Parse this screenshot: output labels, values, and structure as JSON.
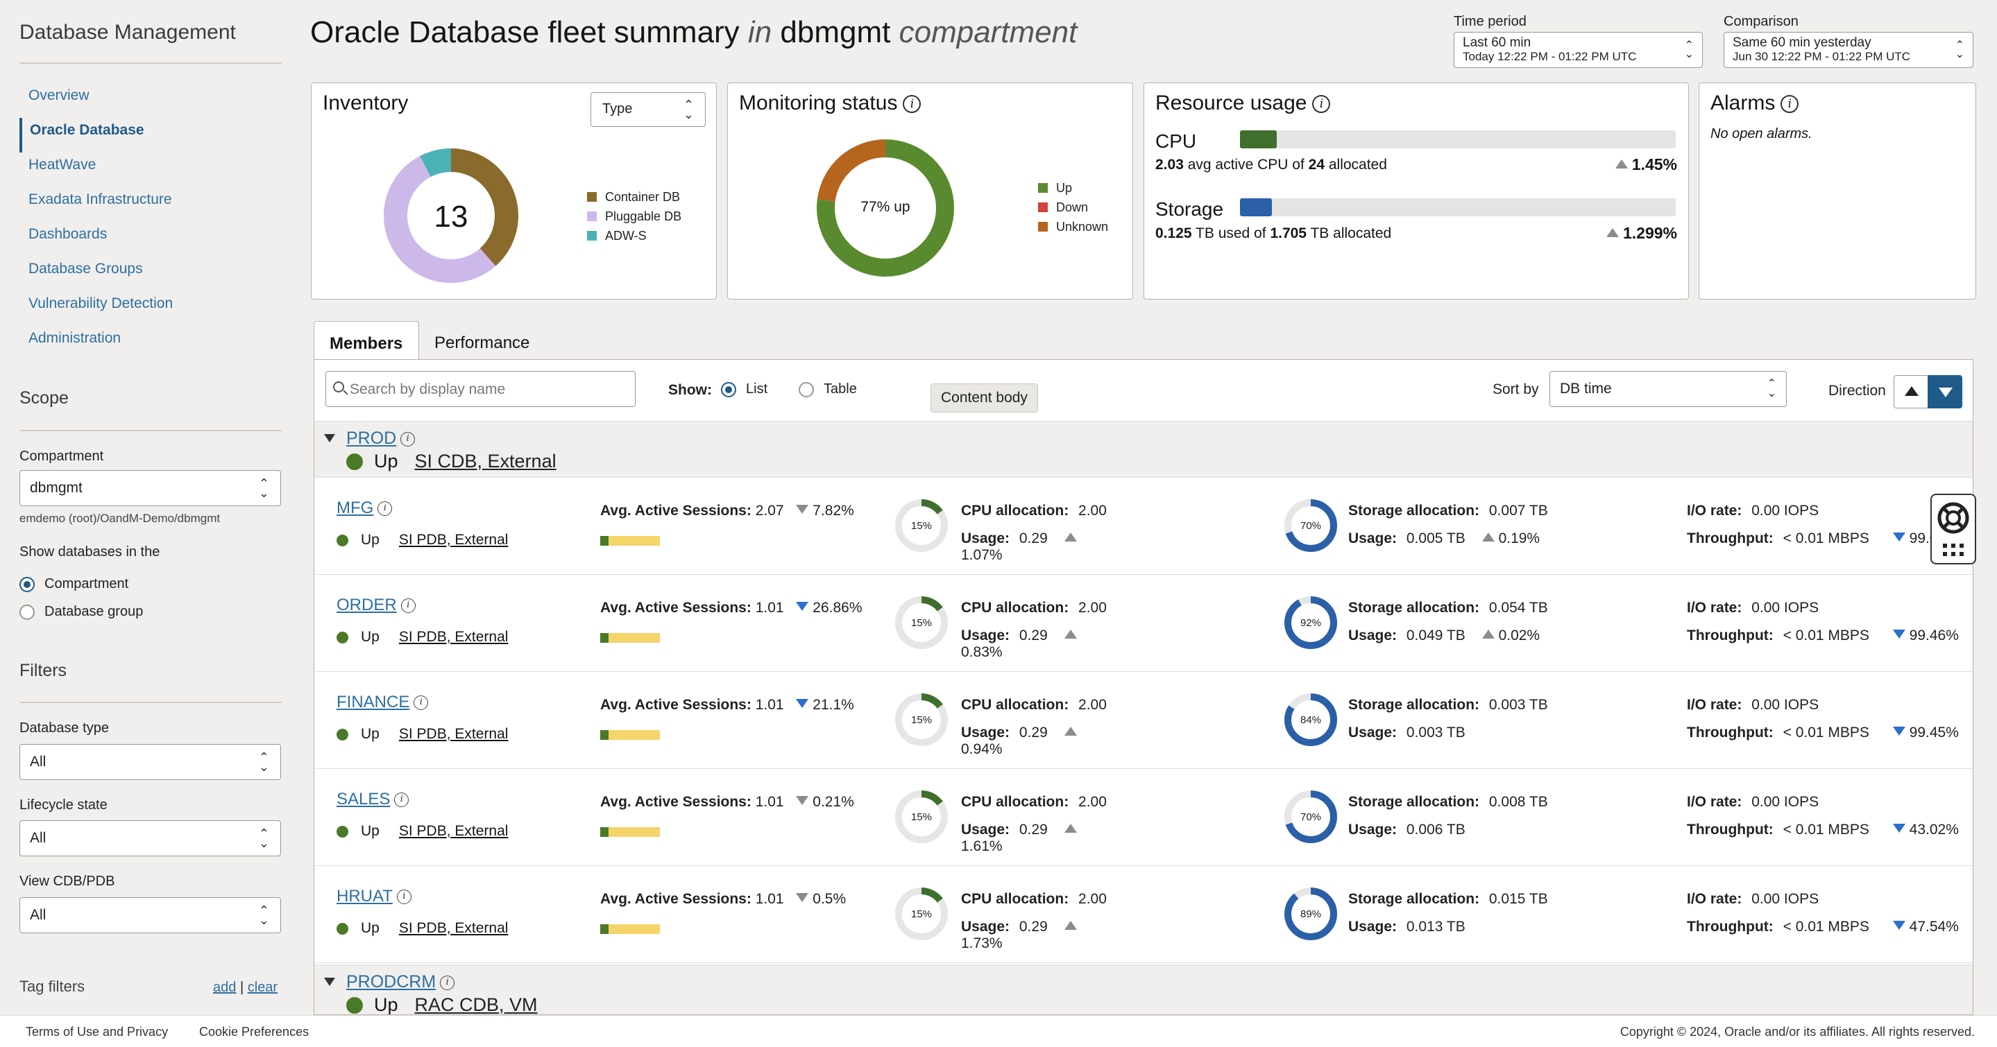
{
  "sidebar": {
    "title": "Database Management",
    "nav": [
      {
        "label": "Overview",
        "active": false
      },
      {
        "label": "Oracle Database",
        "active": true
      },
      {
        "label": "HeatWave",
        "active": false
      },
      {
        "label": "Exadata Infrastructure",
        "active": false
      },
      {
        "label": "Dashboards",
        "active": false
      },
      {
        "label": "Database Groups",
        "active": false
      },
      {
        "label": "Vulnerability Detection",
        "active": false
      },
      {
        "label": "Administration",
        "active": false
      }
    ],
    "scope_heading": "Scope",
    "compartment_label": "Compartment",
    "compartment_value": "dbmgmt",
    "compartment_path": "emdemo (root)/OandM-Demo/dbmgmt",
    "show_db_label": "Show databases in the",
    "radio_compartment": "Compartment",
    "radio_group": "Database group",
    "filters_heading": "Filters",
    "db_type_label": "Database type",
    "db_type_value": "All",
    "lifecycle_label": "Lifecycle state",
    "lifecycle_value": "All",
    "cdbpdb_label": "View CDB/PDB",
    "cdbpdb_value": "All",
    "tag_filters": "Tag filters",
    "add": "add",
    "sep": "|",
    "clear": "clear"
  },
  "header": {
    "title_a": "Oracle Database fleet summary",
    "title_in": "in",
    "title_b": "dbmgmt",
    "title_c": "compartment",
    "time_label": "Time period",
    "time_value": "Last 60 min",
    "time_sub": "Today 12:22 PM - 01:22 PM UTC",
    "comp_label": "Comparison",
    "comp_value": "Same 60 min yesterday",
    "comp_sub": "Jun 30 12:22 PM - 01:22 PM UTC"
  },
  "inventory": {
    "title": "Inventory",
    "type_select": "Type",
    "total": "13",
    "legend": [
      {
        "label": "Container DB",
        "color": "#8b6a2e",
        "value": 5
      },
      {
        "label": "Pluggable DB",
        "color": "#cdb8ea",
        "value": 7
      },
      {
        "label": "ADW-S",
        "color": "#4bb3b5",
        "value": 1
      }
    ]
  },
  "monitoring": {
    "title": "Monitoring status",
    "center": "77% up",
    "legend": [
      {
        "label": "Up",
        "color": "#5a8a2f",
        "value": 77
      },
      {
        "label": "Down",
        "color": "#d1423a",
        "value": 0
      },
      {
        "label": "Unknown",
        "color": "#b5651d",
        "value": 23
      }
    ]
  },
  "resource": {
    "title": "Resource usage",
    "cpu_label": "CPU",
    "cpu_fraction": 0.085,
    "cpu_used": "2.03",
    "cpu_mid": "avg active CPU of",
    "cpu_alloc": "24",
    "cpu_end": "allocated",
    "cpu_pct": "1.45%",
    "storage_label": "Storage",
    "storage_fraction": 0.073,
    "storage_used": "0.125",
    "storage_mid": "TB used of",
    "storage_alloc": "1.705",
    "storage_end": "TB allocated",
    "storage_pct": "1.299%"
  },
  "alarms": {
    "title": "Alarms",
    "text": "No open alarms."
  },
  "tabs": {
    "members": "Members",
    "performance": "Performance"
  },
  "toolbar": {
    "search_placeholder": "Search by display name",
    "show": "Show:",
    "list": "List",
    "table": "Table",
    "tooltip": "Content body",
    "sort_by": "Sort by",
    "sort_value": "DB time",
    "direction": "Direction"
  },
  "labels": {
    "aas": "Avg. Active Sessions:",
    "cpu_alloc": "CPU allocation:",
    "usage": "Usage:",
    "storage_alloc": "Storage allocation:",
    "io_rate": "I/O rate:",
    "throughput": "Throughput:",
    "up": "Up"
  },
  "groups": [
    {
      "name": "PROD",
      "status": "Up",
      "type": "SI CDB, External"
    },
    {
      "name": "PRODCRM",
      "status": "Up",
      "type": "RAC CDB, VM"
    }
  ],
  "members": [
    {
      "name": "MFG",
      "type": "SI PDB, External",
      "aas": "2.07",
      "aas_dir": "down-grey",
      "aas_pct": "7.82%",
      "cpu_pct": 15,
      "cpu_center": "15%",
      "cpu_alloc": "2.00",
      "cpu_usage": "0.29",
      "cpu_usage_pct": "1.07%",
      "stor_pct": 70,
      "stor_center": "70%",
      "stor_alloc": "0.007 TB",
      "stor_usage": "0.005 TB",
      "stor_change": "0.19%",
      "io": "0.00 IOPS",
      "tput": "< 0.01 MBPS",
      "tput_pct": "99.0"
    },
    {
      "name": "ORDER",
      "type": "SI PDB, External",
      "aas": "1.01",
      "aas_dir": "down-blue",
      "aas_pct": "26.86%",
      "cpu_pct": 15,
      "cpu_center": "15%",
      "cpu_alloc": "2.00",
      "cpu_usage": "0.29",
      "cpu_usage_pct": "0.83%",
      "stor_pct": 92,
      "stor_center": "92%",
      "stor_alloc": "0.054 TB",
      "stor_usage": "0.049 TB",
      "stor_change": "0.02%",
      "io": "0.00 IOPS",
      "tput": "< 0.01 MBPS",
      "tput_pct": "99.46%"
    },
    {
      "name": "FINANCE",
      "type": "SI PDB, External",
      "aas": "1.01",
      "aas_dir": "down-blue",
      "aas_pct": "21.1%",
      "cpu_pct": 15,
      "cpu_center": "15%",
      "cpu_alloc": "2.00",
      "cpu_usage": "0.29",
      "cpu_usage_pct": "0.94%",
      "stor_pct": 84,
      "stor_center": "84%",
      "stor_alloc": "0.003 TB",
      "stor_usage": "0.003 TB",
      "stor_change": "",
      "io": "0.00 IOPS",
      "tput": "< 0.01 MBPS",
      "tput_pct": "99.45%"
    },
    {
      "name": "SALES",
      "type": "SI PDB, External",
      "aas": "1.01",
      "aas_dir": "down-grey",
      "aas_pct": "0.21%",
      "cpu_pct": 15,
      "cpu_center": "15%",
      "cpu_alloc": "2.00",
      "cpu_usage": "0.29",
      "cpu_usage_pct": "1.61%",
      "stor_pct": 70,
      "stor_center": "70%",
      "stor_alloc": "0.008 TB",
      "stor_usage": "0.006 TB",
      "stor_change": "",
      "io": "0.00 IOPS",
      "tput": "< 0.01 MBPS",
      "tput_pct": "43.02%"
    },
    {
      "name": "HRUAT",
      "type": "SI PDB, External",
      "aas": "1.01",
      "aas_dir": "down-grey",
      "aas_pct": "0.5%",
      "cpu_pct": 15,
      "cpu_center": "15%",
      "cpu_alloc": "2.00",
      "cpu_usage": "0.29",
      "cpu_usage_pct": "1.73%",
      "stor_pct": 89,
      "stor_center": "89%",
      "stor_alloc": "0.015 TB",
      "stor_usage": "0.013 TB",
      "stor_change": "",
      "io": "0.00 IOPS",
      "tput": "< 0.01 MBPS",
      "tput_pct": "47.54%"
    }
  ],
  "footer": {
    "terms": "Terms of Use and Privacy",
    "cookies": "Cookie Preferences",
    "copyright": "Copyright © 2024, Oracle and/or its affiliates. All rights reserved."
  },
  "icons": [
    "info-icon",
    "search-icon",
    "chevron-updown-icon",
    "help-lifebuoy-icon",
    "apps-grid-icon",
    "sort-asc-icon",
    "sort-desc-icon"
  ]
}
